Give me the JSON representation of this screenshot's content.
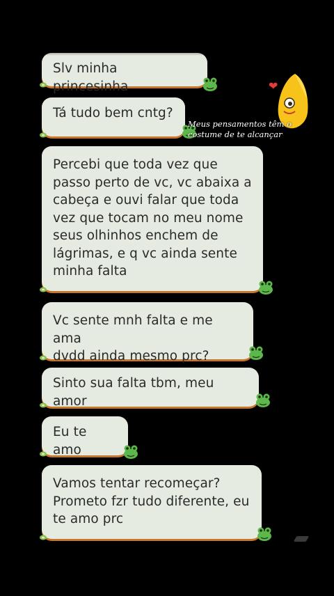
{
  "messages": [
    {
      "text": "Slv minha princesinha"
    },
    {
      "text": "Tá tudo bem cntg?"
    },
    {
      "text": "Percebi que toda vez que\npasso perto de vc, vc abaixa a\ncabeça e ouvi falar que toda\nvez que tocam no meu nome\nseus olhinhos enchem de\nlágrimas, e q vc ainda sente\nminha falta"
    },
    {
      "text": "Vc sente mnh falta e me ama\ndvdd ainda mesmo prc?"
    },
    {
      "text": "Sinto sua falta tbm, meu amor"
    },
    {
      "text": "Eu te amo"
    },
    {
      "text": "Vamos tentar recomeçar?\nPrometo fzr tudo diferente, eu\nte amo prc"
    }
  ],
  "sticker": {
    "caption": "Meus pensamentos têm o\ncostume de te alcançar"
  },
  "colors": {
    "background": "#000000",
    "bubble": "#e6ebe1",
    "bubble_shadow": "#c8742a",
    "frog": "#5cb84a"
  },
  "icons": {
    "frog": "frog-sticker-icon",
    "leaf": "leaf-icon",
    "heart": "heart-icon",
    "egg": "egg-character-icon"
  }
}
